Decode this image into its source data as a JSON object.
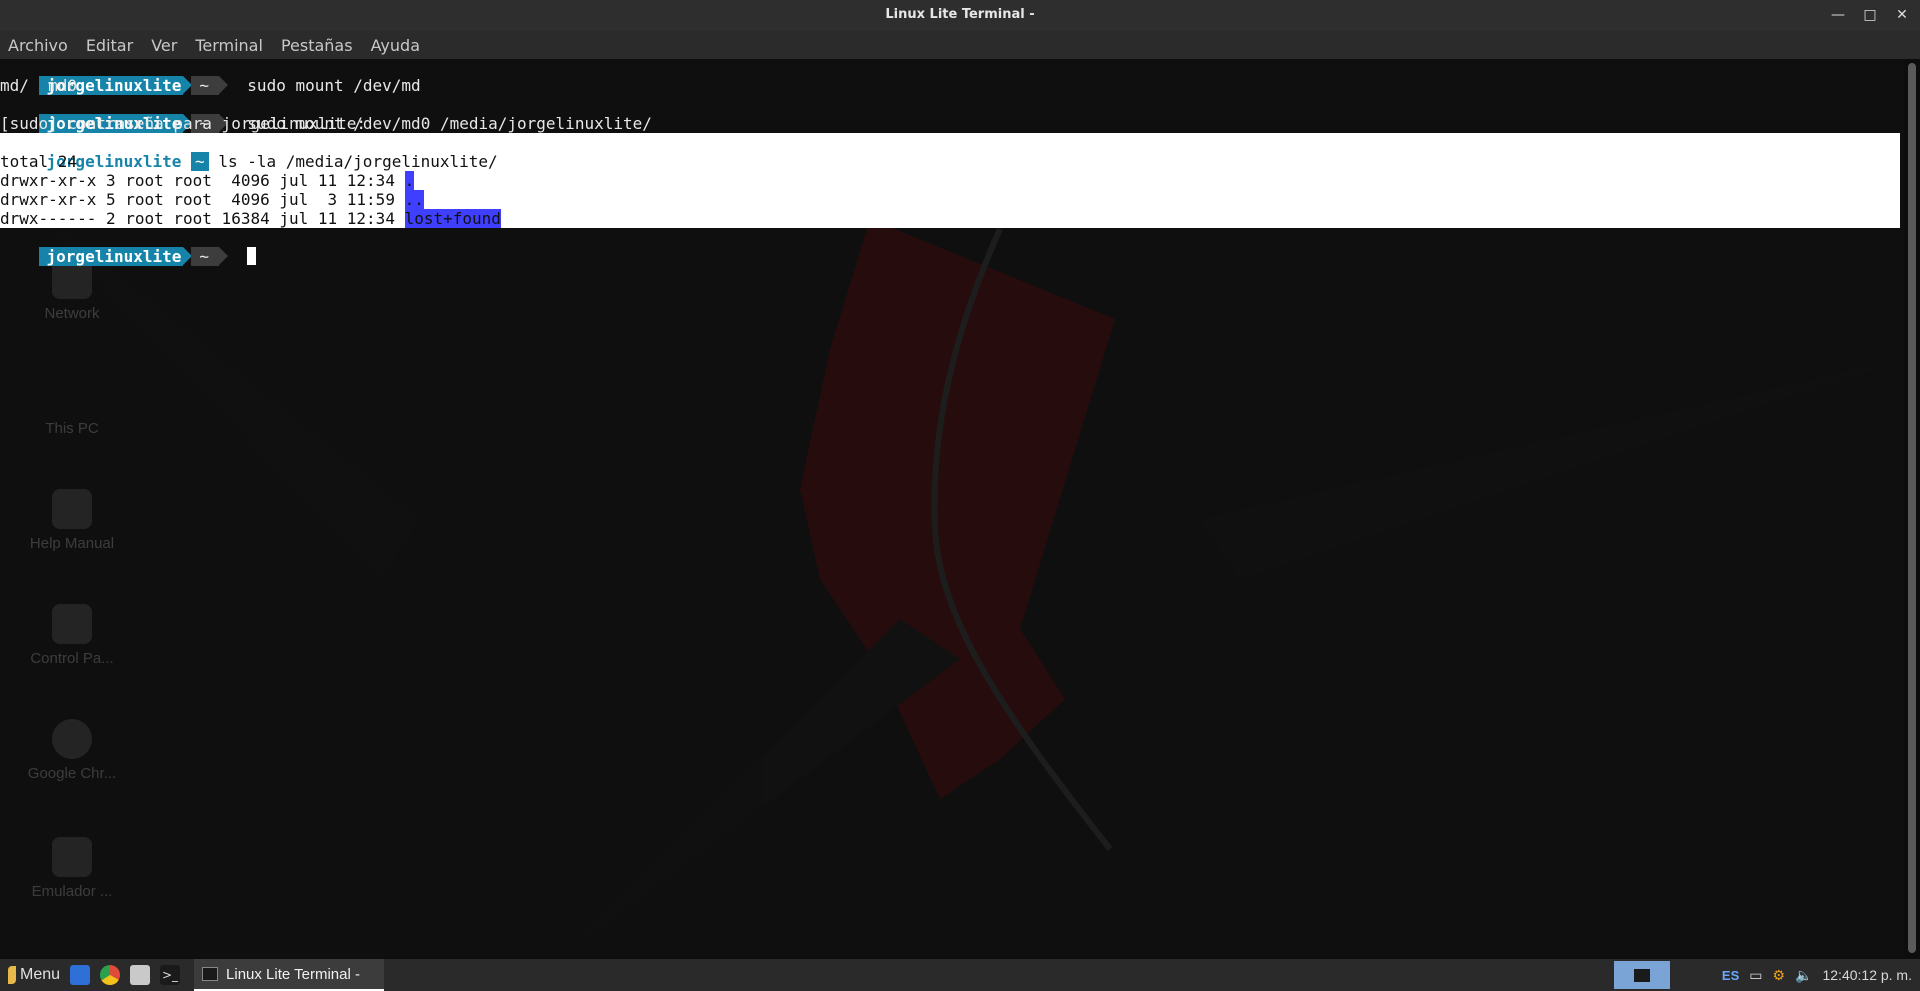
{
  "window": {
    "title": "Linux Lite Terminal -"
  },
  "menu": [
    "Archivo",
    "Editar",
    "Ver",
    "Terminal",
    "Pestañas",
    "Ayuda"
  ],
  "prompt": {
    "user": "jorgelinuxlite",
    "home": "~"
  },
  "terminal_lines": {
    "cmd1": "sudo mount /dev/md",
    "out1": "md/  md0",
    "cmd2": "sudo mount /dev/md0 /media/jorgelinuxlite/",
    "out2": "[sudo] contraseña para jorgelinuxlite:",
    "cmd3": "ls -la /media/jorgelinuxlite/",
    "total": "total 24",
    "rows": [
      {
        "perm": "drwxr-xr-x 3 root root  4096 jul 11 12:34 ",
        "name": "."
      },
      {
        "perm": "drwxr-xr-x 5 root root  4096 jul  3 11:59 ",
        "name": ".."
      },
      {
        "perm": "drwx------ 2 root root 16384 jul 11 12:34 ",
        "name": "lost+found"
      }
    ]
  },
  "desktop_icons": [
    "Network",
    "This PC",
    "Help Manual",
    "Control Pa...",
    "Google Chr...",
    "Emulador ..."
  ],
  "taskbar": {
    "menu_label": "Menu",
    "task_label": "Linux Lite Terminal -",
    "lang": "ES",
    "clock": "12:40:12 p. m."
  },
  "colors": {
    "prompt_bg": "#1584a8",
    "selection": "#ffffff",
    "dir_highlight": "#3f3fff"
  }
}
